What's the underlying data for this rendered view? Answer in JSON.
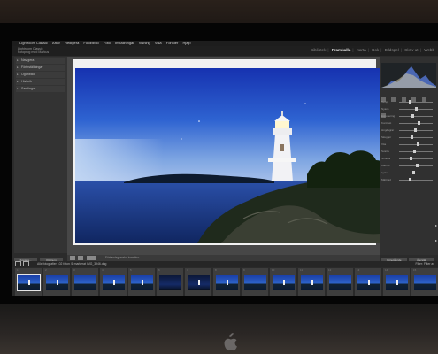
{
  "app": {
    "menu": [
      "Lightroom Classic",
      "Arkiv",
      "Redigera",
      "Fotobiblio",
      "Foto",
      "Inställningar",
      "Visning",
      "Visa",
      "Fönster",
      "Hjälp"
    ],
    "catalog_lines": [
      "Lightroom Classic",
      "Fotoprog med Markus"
    ],
    "modules": [
      "Bibliotek",
      "Framkalla",
      "Karta",
      "Bok",
      "Bildspel",
      "Skriv ut",
      "Webb"
    ],
    "active_module": "Framkalla"
  },
  "left_panel": {
    "items": [
      "Navigera",
      "Förinställningar",
      "Ögonblick",
      "Historik",
      "Samlingar"
    ],
    "buttons": [
      "Kopiera...",
      "Klistra in"
    ]
  },
  "toolbar": {
    "soft_proof_label": "Förhandsgranska korrektur"
  },
  "right_panel": {
    "sliders": [
      "Temp",
      "Nyans",
      "Exponering",
      "Kontrast",
      "Högdagrar",
      "Skuggor",
      "Vita",
      "Svarta",
      "Struktur",
      "Klarhet",
      "Lyster",
      "Mättnad"
    ],
    "buttons": [
      "Föregående",
      "Återställ"
    ]
  },
  "filmstrip": {
    "header_text": "Alla fotografier",
    "count_text": "102 foton /1 markerat",
    "filename": "IMG_3946.dng",
    "filter_label": "Filter:",
    "filter_value": "Filter av",
    "frames": [
      "1",
      "2",
      "3",
      "4",
      "5",
      "6",
      "7",
      "8",
      "9",
      "10",
      "11",
      "12",
      "13",
      "14",
      "15"
    ],
    "selected_index": 0
  },
  "colors": {
    "sky_top": "#1836b8",
    "sky_mid": "#3b74d8",
    "horizon_glow": "#9bb8e6",
    "lightroom_dark": "#2b2b2b"
  }
}
